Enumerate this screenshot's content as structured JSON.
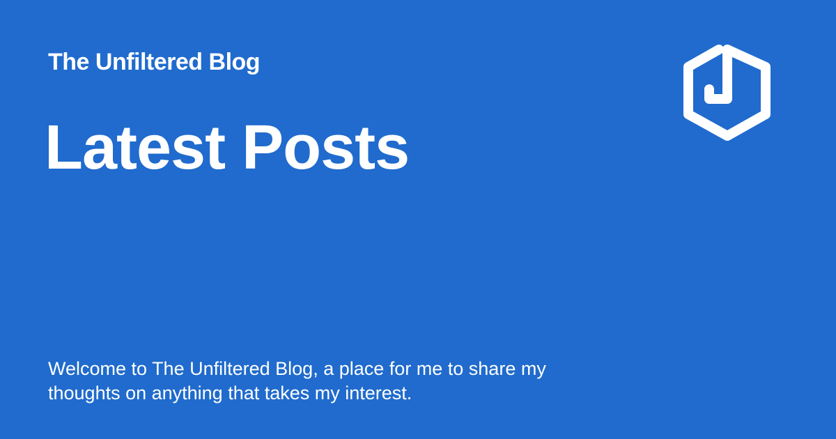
{
  "blog": {
    "name": "The Unfiltered Blog"
  },
  "page": {
    "title": "Latest Posts",
    "description": "Welcome to The Unfiltered Blog, a place for me to share my thoughts on anything that takes my interest."
  },
  "logo": {
    "icon": "hexagon-j-logo-icon",
    "color": "#ffffff"
  },
  "colors": {
    "background": "#206bcd",
    "text": "#ffffff"
  }
}
